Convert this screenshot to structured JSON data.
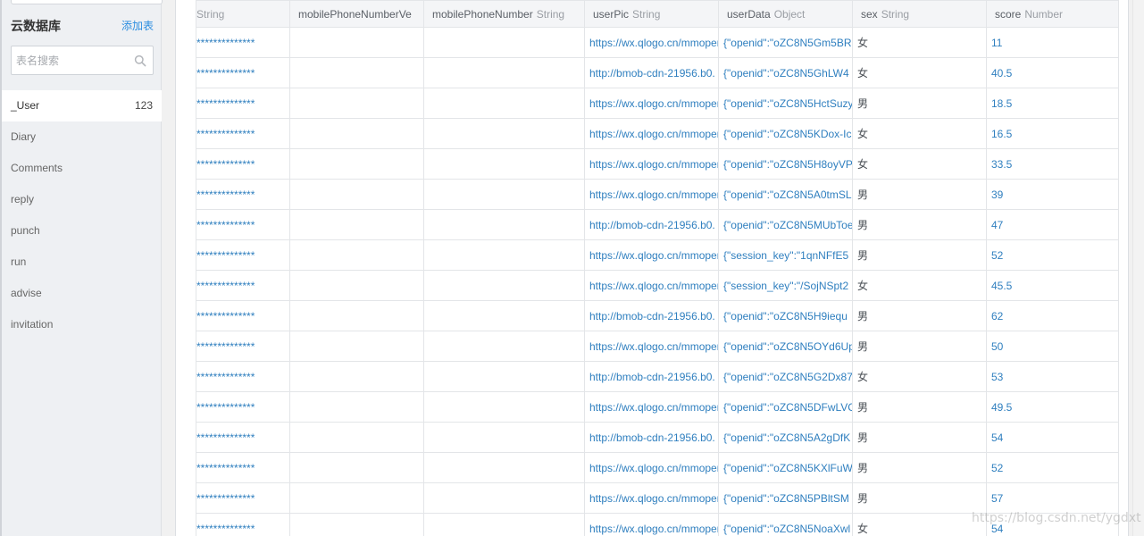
{
  "sidebar": {
    "title": "云数据库",
    "add_label": "添加表",
    "search_placeholder": "表名搜索",
    "items": [
      {
        "label": "_User",
        "count": "123"
      },
      {
        "label": "Diary",
        "count": ""
      },
      {
        "label": "Comments",
        "count": ""
      },
      {
        "label": "reply",
        "count": ""
      },
      {
        "label": "punch",
        "count": ""
      },
      {
        "label": "run",
        "count": ""
      },
      {
        "label": "advise",
        "count": ""
      },
      {
        "label": "invitation",
        "count": ""
      }
    ]
  },
  "table": {
    "columns": [
      {
        "name": "",
        "type": "String"
      },
      {
        "name": "mobilePhoneNumberVe",
        "type": ""
      },
      {
        "name": "mobilePhoneNumber",
        "type": "String"
      },
      {
        "name": "userPic",
        "type": "String"
      },
      {
        "name": "userData",
        "type": "Object"
      },
      {
        "name": "sex",
        "type": "String"
      },
      {
        "name": "score",
        "type": "Number"
      }
    ],
    "rows": [
      [
        "**************",
        "",
        "",
        "https://wx.qlogo.cn/mmopen",
        "{\"openid\":\"oZC8N5Gm5BR",
        "女",
        "11"
      ],
      [
        "**************",
        "",
        "",
        "http://bmob-cdn-21956.b0.",
        "{\"openid\":\"oZC8N5GhLW4",
        "女",
        "40.5"
      ],
      [
        "**************",
        "",
        "",
        "https://wx.qlogo.cn/mmopen",
        "{\"openid\":\"oZC8N5HctSuzy",
        "男",
        "18.5"
      ],
      [
        "**************",
        "",
        "",
        "https://wx.qlogo.cn/mmopen",
        "{\"openid\":\"oZC8N5KDox-Ic",
        "女",
        "16.5"
      ],
      [
        "**************",
        "",
        "",
        "https://wx.qlogo.cn/mmopen",
        "{\"openid\":\"oZC8N5H8oyVP",
        "女",
        "33.5"
      ],
      [
        "**************",
        "",
        "",
        "https://wx.qlogo.cn/mmopen",
        "{\"openid\":\"oZC8N5A0tmSL",
        "男",
        "39"
      ],
      [
        "**************",
        "",
        "",
        "http://bmob-cdn-21956.b0.",
        "{\"openid\":\"oZC8N5MUbToe",
        "男",
        "47"
      ],
      [
        "**************",
        "",
        "",
        "https://wx.qlogo.cn/mmopen",
        "{\"session_key\":\"1qnNFfE5",
        "男",
        "52"
      ],
      [
        "**************",
        "",
        "",
        "https://wx.qlogo.cn/mmopen",
        "{\"session_key\":\"/SojNSpt2",
        "女",
        "45.5"
      ],
      [
        "**************",
        "",
        "",
        "http://bmob-cdn-21956.b0.",
        "{\"openid\":\"oZC8N5H9iequ",
        "男",
        "62"
      ],
      [
        "**************",
        "",
        "",
        "https://wx.qlogo.cn/mmopen",
        "{\"openid\":\"oZC8N5OYd6Up",
        "男",
        "50"
      ],
      [
        "**************",
        "",
        "",
        "http://bmob-cdn-21956.b0.",
        "{\"openid\":\"oZC8N5G2Dx87",
        "女",
        "53"
      ],
      [
        "**************",
        "",
        "",
        "https://wx.qlogo.cn/mmopen",
        "{\"openid\":\"oZC8N5DFwLVC",
        "男",
        "49.5"
      ],
      [
        "**************",
        "",
        "",
        "http://bmob-cdn-21956.b0.",
        "{\"openid\":\"oZC8N5A2gDfK",
        "男",
        "54"
      ],
      [
        "**************",
        "",
        "",
        "https://wx.qlogo.cn/mmopen",
        "{\"openid\":\"oZC8N5KXlFuW",
        "男",
        "52"
      ],
      [
        "**************",
        "",
        "",
        "https://wx.qlogo.cn/mmopen",
        "{\"openid\":\"oZC8N5PBltSM",
        "男",
        "57"
      ],
      [
        "**************",
        "",
        "",
        "https://wx.qlogo.cn/mmopen",
        "{\"openid\":\"oZC8N5NoaXwl",
        "女",
        "54"
      ]
    ]
  },
  "watermark": "https://blog.csdn.net/ygdxt",
  "colors": {
    "link": "#2f7fbf",
    "accent": "#2d8ee0",
    "sidebar_bg": "#eef0f3"
  },
  "icons": {
    "search": "search-icon"
  }
}
